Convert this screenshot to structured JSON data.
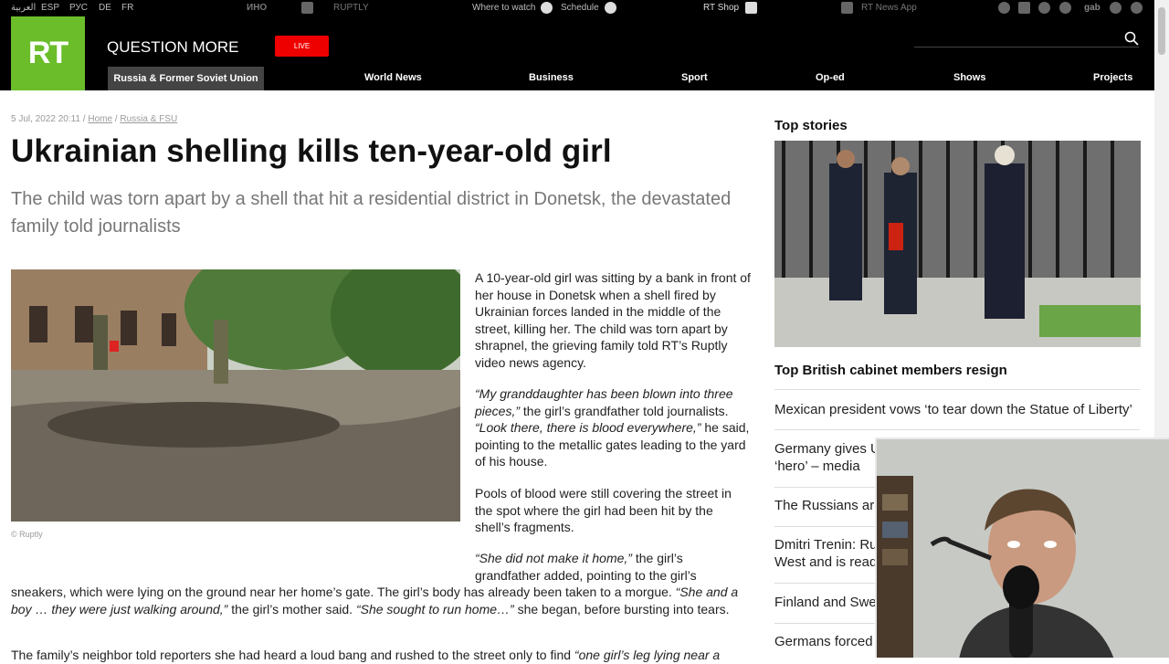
{
  "topbar": {
    "languages": [
      "العربية",
      "ESP",
      "РУС",
      "DE",
      "FR"
    ],
    "partners": [
      "ИНО",
      "RUPTLY"
    ],
    "where_to_watch": "Where to watch",
    "schedule": "Schedule",
    "shop": "RT Shop",
    "news_app": "RT News App",
    "social": [
      "telegram-icon",
      "rss-icon",
      "twitter-icon",
      "vk-icon",
      "gab-icon",
      "odnoklassniki-icon",
      "other-icon"
    ]
  },
  "header": {
    "logo": "RT",
    "slogan": "QUESTION MORE",
    "live": "LIVE",
    "nav_active": "Russia & Former Soviet Union",
    "nav": [
      "World News",
      "Business",
      "Sport",
      "Op-ed",
      "Shows",
      "Projects"
    ]
  },
  "article": {
    "date": "5 Jul, 2022 20:11",
    "crumb_home": "Home",
    "crumb_section": "Russia & FSU",
    "title": "Ukrainian shelling kills ten-year-old girl",
    "subtitle": "The child was torn apart by a shell that hit a residential district in Donetsk, the devastated family told journalists",
    "caption": "© Ruptly",
    "p1": "A 10-year-old girl was sitting by a bank in front of her house in Donetsk when a shell fired by Ukrainian forces landed in the middle of the street, killing her. The child was torn apart by shrapnel, the grieving family told RT’s Ruptly video news agency.",
    "p2_quote1": "“My granddaughter has been blown into three pieces,”",
    "p2_text1": " the girl’s grandfather told journalists. ",
    "p2_quote2": "“Look there, there is blood everywhere,”",
    "p2_text2": " he said, pointing to the metallic gates leading to the yard of his house.",
    "p3": "Pools of blood were still covering the street in the spot where the girl had been hit by the shell’s fragments.",
    "p4_quote": "“She did not make it home,”",
    "p4_text": " the girl’s grandfather added, pointing to the girl’s",
    "p5_text1": "sneakers, which were lying on the ground near her home’s gate. The girl’s body has already been taken to a morgue. ",
    "p5_quote1": "“She and a boy … they were just walking around,”",
    "p5_text2": " the girl’s mother said. ",
    "p5_quote2": "“She sought to run home…”",
    "p5_text3": " she began, before bursting into tears.",
    "p6_text": "The family’s neighbor told reporters she had heard a loud bang and rushed to the street only to find ",
    "p6_quote": "“one girl’s leg lying near a"
  },
  "sidebar": {
    "heading": "Top stories",
    "lead": "Top British cabinet members resign",
    "items": [
      "Mexican president vows ‘to tear down the Statue of Liberty’",
      "Germany gives U",
      "‘hero’ – media",
      "The Russians are",
      "Dmitri Trenin: Rus",
      "West and is ready",
      "Finland and Swed",
      "Germans forced t"
    ]
  },
  "colors": {
    "brand_green": "#6bbd2a",
    "live_red": "#e00000",
    "header_bg": "#000000"
  }
}
